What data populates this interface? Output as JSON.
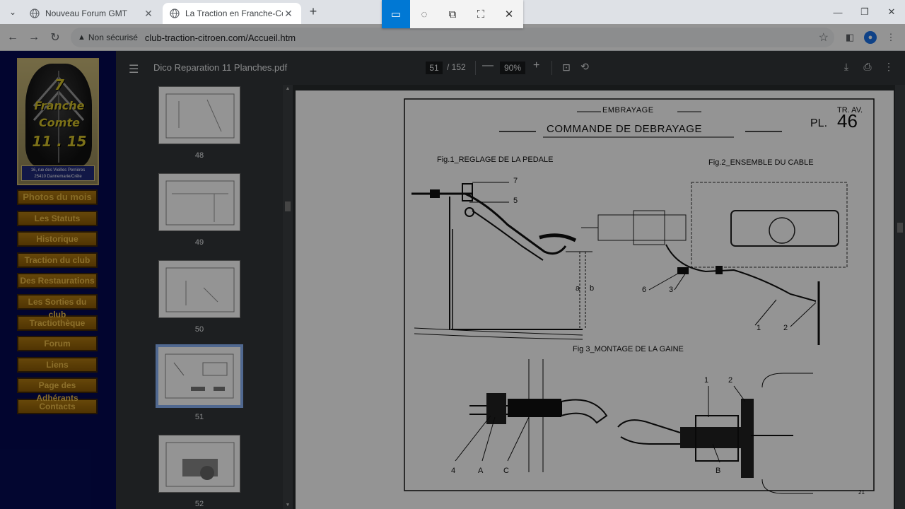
{
  "browser": {
    "tabs": [
      {
        "title": "Nouveau Forum GMT"
      },
      {
        "title": "La Traction en Franche-Comté"
      }
    ],
    "security_label": "Non sécurisé",
    "url": "club-traction-citroen.com/Accueil.htm"
  },
  "site": {
    "logo": {
      "line1": "7",
      "line2": "Franche",
      "line3": "Comte",
      "line4": "11 . 15",
      "address_line1": "16, rue des Vieilles Perrières",
      "address_line2": "25410 Dannemarie/Crête"
    },
    "menu": [
      {
        "label": "Photos du mois"
      },
      {
        "label": "Les Statuts"
      },
      {
        "label": "Historique"
      },
      {
        "label": "Traction du club"
      },
      {
        "label": "Des Restaurations"
      },
      {
        "label": "Les Sorties du club"
      },
      {
        "label": "Tractiothèque"
      },
      {
        "label": "Forum"
      },
      {
        "label": "Liens"
      },
      {
        "label": "Page des Adhérants"
      },
      {
        "label": "Contacts"
      }
    ]
  },
  "pdf": {
    "filename": "Dico Reparation 11 Planches.pdf",
    "current_page": "51",
    "total_pages": "/ 152",
    "zoom": "90%",
    "thumbnails": [
      {
        "num": "48"
      },
      {
        "num": "49"
      },
      {
        "num": "50"
      },
      {
        "num": "51"
      },
      {
        "num": "52"
      }
    ],
    "page": {
      "section": "EMBRAYAGE",
      "title": "COMMANDE DE DEBRAYAGE",
      "tr_av": "TR. AV.",
      "pl": "PL.",
      "pl_num": "46",
      "fig1": "Fig.1_REGLAGE DE LA PEDALE",
      "fig2": "Fig.2_ENSEMBLE DU CABLE",
      "fig3": "Fig 3_MONTAGE DE LA GAINE",
      "labels": {
        "l7": "7",
        "l5": "5",
        "la": "a",
        "lb": "b",
        "l6": "6",
        "l3": "3",
        "l1": "1",
        "l2": "2",
        "l4": "4",
        "lA": "A",
        "lC": "C",
        "lB": "B",
        "f3_1": "1",
        "f3_2": "2",
        "page_no": "21"
      }
    }
  },
  "snip_tool": {
    "modes": [
      "rectangle-snip",
      "freeform-snip",
      "window-snip",
      "fullscreen-snip",
      "close"
    ]
  }
}
